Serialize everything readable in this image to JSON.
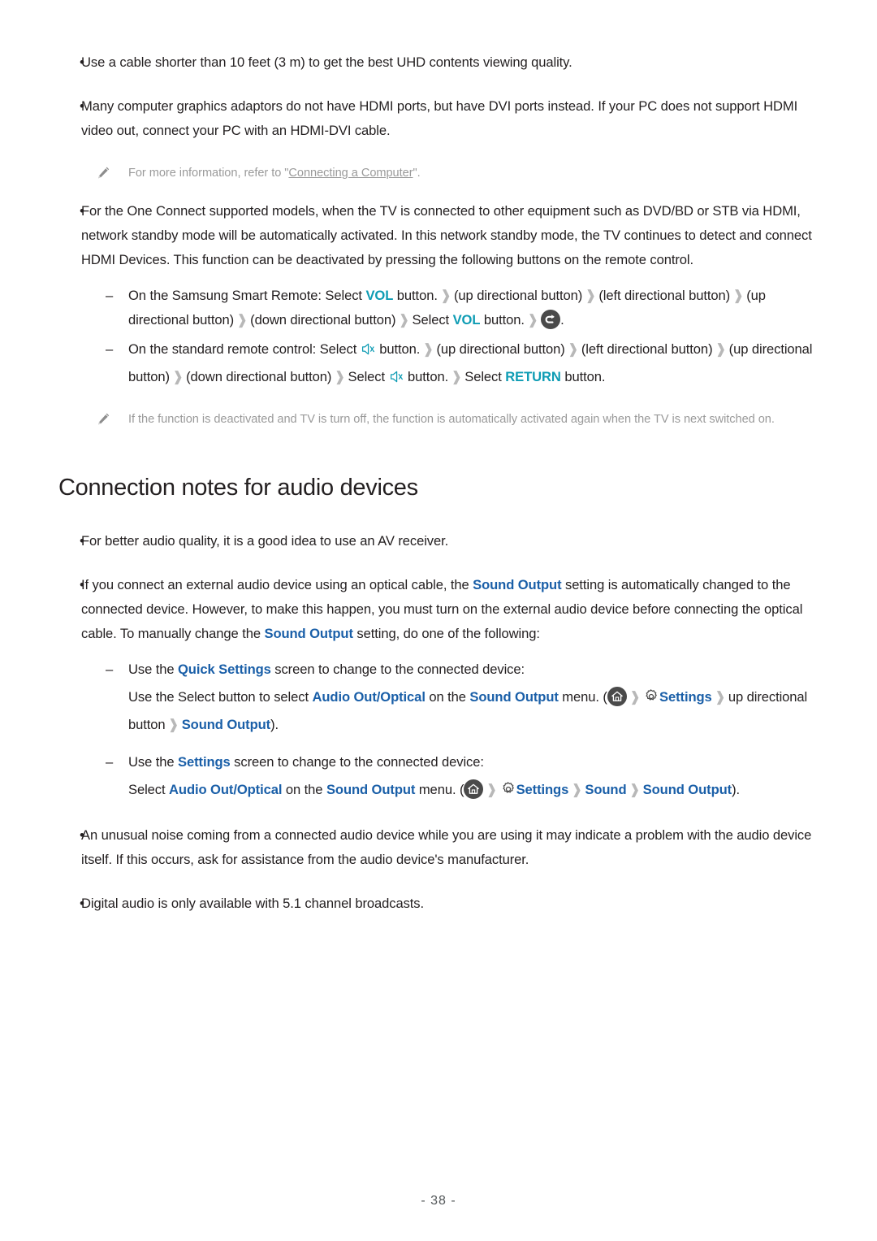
{
  "page": {
    "footer": "- 38 -"
  },
  "colors": {
    "teal": "#0e9cb4",
    "blue": "#1a5fa8",
    "body_text": "#231f20",
    "note_text": "#9a9a9a",
    "chevron": "#b8b8b8",
    "icon_dark": "#4a4a4a"
  },
  "bullets_top": [
    {
      "text": "Use a cable shorter than 10 feet (3 m) to get the best UHD contents viewing quality."
    },
    {
      "text": "Many computer graphics adaptors do not have HDMI ports, but have DVI ports instead. If your PC does not support HDMI video out, connect your PC with an HDMI-DVI cable."
    }
  ],
  "note_computer": {
    "icon": "pencil-icon",
    "prefix": "For more information, refer to \"",
    "link": "Connecting a Computer",
    "suffix": "\"."
  },
  "bullet_one_connect": {
    "text": "For the One Connect supported models, when the TV is connected to other equipment such as DVD/BD or STB via HDMI, network standby mode will be automatically activated. In this network standby mode, the TV continues to detect and connect HDMI Devices. This function can be deactivated by pressing the following buttons on the remote control."
  },
  "smart_remote_step": {
    "seg1": "On the Samsung Smart Remote: Select ",
    "vol1": "VOL",
    "seg2": " button.",
    "chevron": "›",
    "seg3": "(up directional button)",
    "seg4": "(left directional button)",
    "seg5": "(up directional button)",
    "seg6": "(down directional button)",
    "seg7": "Select ",
    "vol2": "VOL",
    "seg8": " button.",
    "return_icon": "return-arrow-icon",
    "period": "."
  },
  "standard_remote_step": {
    "seg1": "On the standard remote control: Select ",
    "mute_icon": "mute-speaker-icon",
    "seg2": " button.",
    "seg3": "(up directional button)",
    "seg4": "(left directional button)",
    "seg5": "(up directional button)",
    "seg6": "(down directional button)",
    "seg7": "Select ",
    "seg8": " button.",
    "seg9": "Select ",
    "return_label": "RETURN",
    "seg10": " button."
  },
  "note_deactivated": {
    "icon": "pencil-icon",
    "text": "If the function is deactivated and TV is turn off, the function is automatically activated again when the TV is next switched on."
  },
  "heading_audio": "Connection notes for audio devices",
  "bullets_audio": [
    {
      "text": "For better audio quality, it is a good idea to use an AV receiver."
    }
  ],
  "bullet_optical": {
    "seg1": "If you connect an external audio device using an optical cable, the ",
    "kw1": "Sound Output",
    "seg2": " setting is automatically changed to the connected device. However, to make this happen, you must turn on the external audio device before connecting the optical cable. To manually change the ",
    "kw2": "Sound Output",
    "seg3": " setting, do one of the following:"
  },
  "quick_settings_step": {
    "seg1": "Use the ",
    "kw1": "Quick Settings",
    "seg2": " screen to change to the connected device:"
  },
  "quick_settings_path": {
    "seg1": "Use the Select button to select ",
    "kw1": "Audio Out/Optical",
    "seg2": " on the ",
    "kw2": "Sound Output",
    "seg3": " menu. (",
    "home_icon": "home-icon",
    "gear_icon": "gear-icon",
    "kw3": "Settings",
    "seg4": "up directional button",
    "kw4": "Sound Output",
    "seg5": ")."
  },
  "settings_step": {
    "seg1": "Use the ",
    "kw1": "Settings",
    "seg2": " screen to change to the connected device:"
  },
  "settings_path": {
    "seg1": "Select ",
    "kw1": "Audio Out/Optical",
    "seg2": " on the ",
    "kw2": "Sound Output",
    "seg3": " menu. (",
    "home_icon": "home-icon",
    "gear_icon": "gear-icon",
    "kw3": "Settings",
    "kw4": "Sound",
    "kw5": "Sound Output",
    "seg4": ")."
  },
  "bullets_bottom": [
    {
      "text": "An unusual noise coming from a connected audio device while you are using it may indicate a problem with the audio device itself. If this occurs, ask for assistance from the audio device's manufacturer."
    },
    {
      "text": "Digital audio is only available with 5.1 channel broadcasts."
    }
  ]
}
